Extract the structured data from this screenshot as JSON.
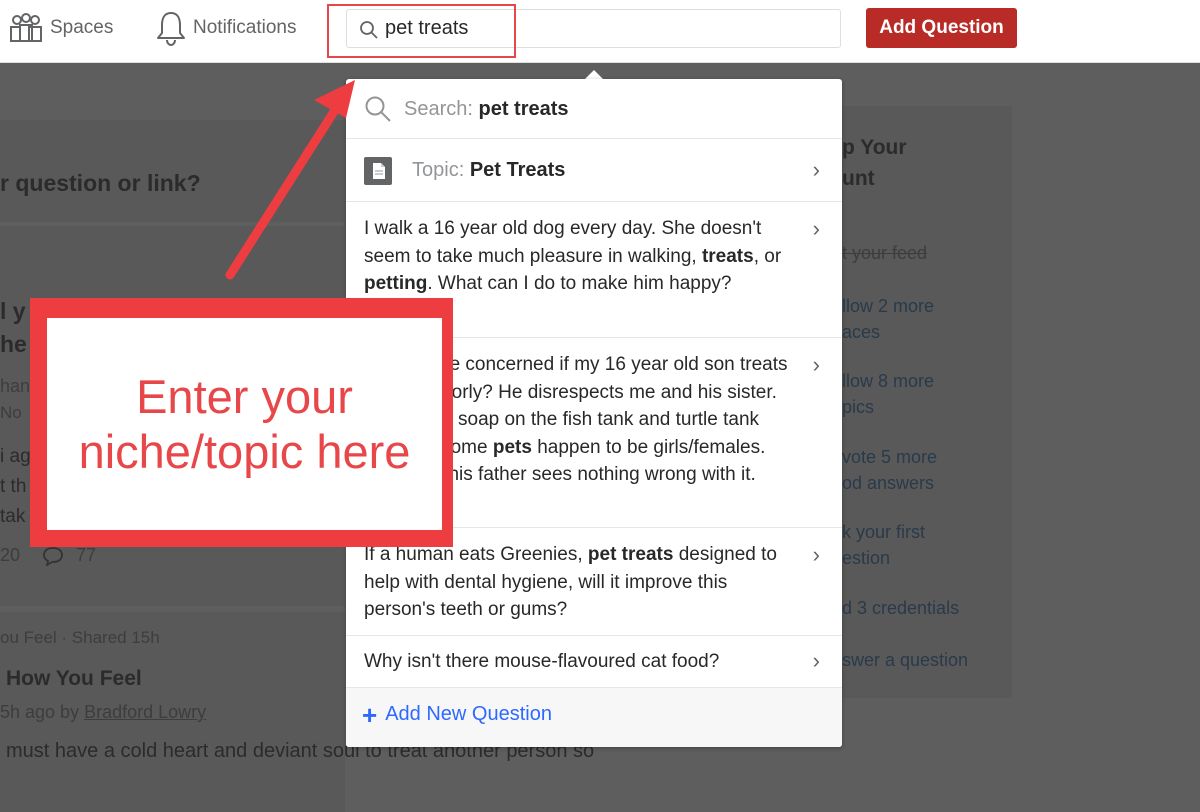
{
  "navbar": {
    "spaces_label": "Spaces",
    "notifications_label": "Notifications",
    "search_value": "pet treats",
    "add_question_label": "Add Question"
  },
  "background": {
    "ask_prompt": "r question or link?",
    "feed_title_fragment_1": "l y",
    "feed_title_fragment_2": "he",
    "feed_author_fragment": "han",
    "feed_date_fragment": "No",
    "feed_line_1": "i ag",
    "feed_line_2": "t th",
    "feed_line_3": "tak",
    "upvotes_fragment": "20",
    "comments_fragment": "77",
    "shared_line": "ou Feel · Shared 15h",
    "post_title": "How You Feel",
    "post_meta_prefix": "5h ago by",
    "post_author": "Bradford Lowry",
    "post_excerpt": "must have a cold heart and deviant soul to treat another person so",
    "sidebar_title_1": "p Your",
    "sidebar_title_2": "unt",
    "sidebar_items": [
      "t your feed",
      "llow 2 more",
      "aces",
      "llow 8 more",
      "pics",
      "vote 5 more",
      "od answers",
      "k your first",
      "estion",
      "d 3 credentials",
      "swer a question"
    ]
  },
  "dropdown": {
    "search_prefix": "Search:",
    "search_query": "pet treats",
    "topic_prefix": "Topic:",
    "topic_name": "Pet Treats",
    "results": [
      {
        "parts": [
          "I walk a 16 year old dog every day. She doesn't seem to take much pleasure in walking, ",
          "treats",
          ", or ",
          "petting",
          ". What can I do to make him happy?"
        ]
      },
      {
        "parts": [
          "Should I be concerned if my 16 year old son treats women poorly? He disrespects me and his sister. He poured soap on the fish tank and turtle tank because some ",
          "pets",
          " happen to be girls/females. However, his father sees nothing wrong with it."
        ]
      },
      {
        "parts": [
          "If a human eats Greenies, ",
          "pet treats",
          " designed to help with dental hygiene, will it improve this person's teeth or gums?"
        ]
      },
      {
        "parts": [
          "Why isn't there mouse-flavoured cat food?"
        ]
      }
    ],
    "add_new_label": "Add New Question"
  },
  "annotation": {
    "line_1": "Enter your",
    "line_2": "niche/topic here"
  },
  "colors": {
    "brand_red": "#b92b27",
    "annotation_red": "#ed3d40",
    "link_blue": "#2e69ff"
  },
  "icons": [
    "spaces-icon",
    "bell-icon",
    "search-icon",
    "topic-icon",
    "chevron-right-icon",
    "plus-icon",
    "arrow-annotation"
  ]
}
